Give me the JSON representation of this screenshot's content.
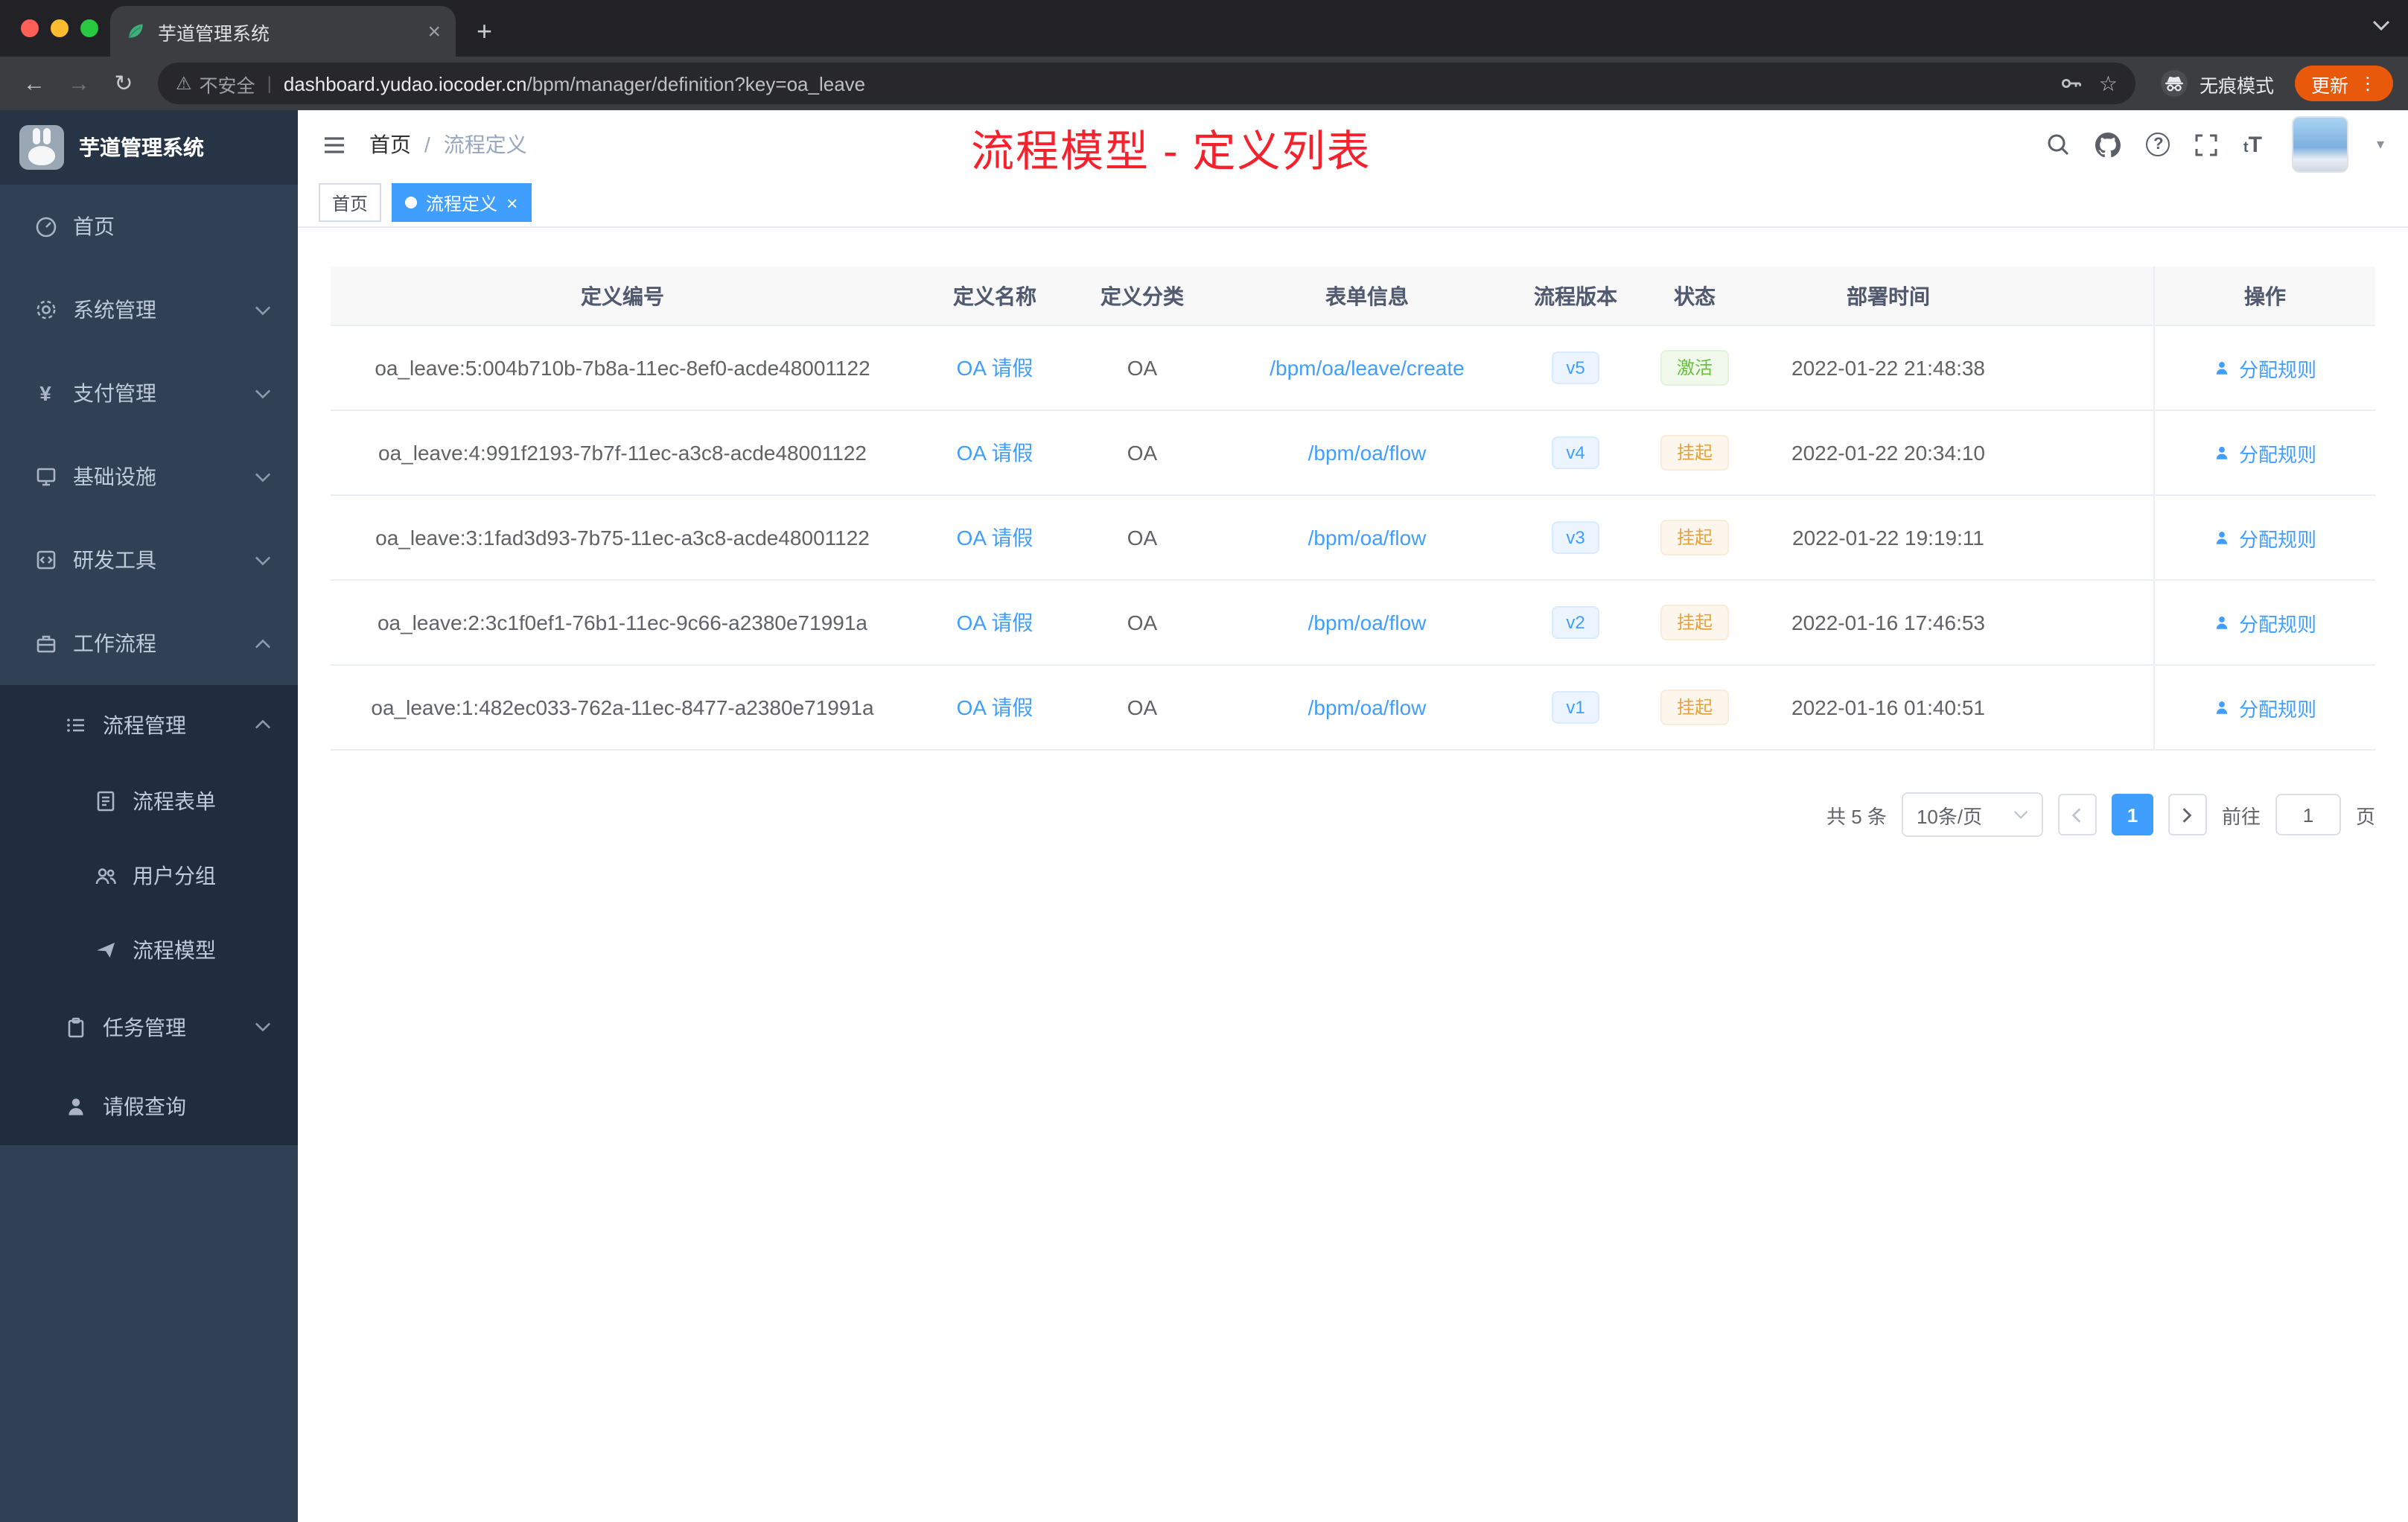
{
  "colors": {
    "accent": "#409eff",
    "success": "#67c23a",
    "warning": "#e6a23c",
    "annotation_red": "#f5222d",
    "sidebar_bg": "#304156",
    "submenu_bg": "#1f2d3d"
  },
  "icons": {
    "close": "×",
    "new_tab": "+",
    "back": "←",
    "forward": "→",
    "reload": "↻",
    "warning": "⚠",
    "star": "☆",
    "menu_dots": "⋮",
    "question": "?",
    "yen": "¥",
    "caret_down": "▾",
    "font_size": "tT",
    "separator": "|"
  },
  "browser": {
    "tab_title": "芋道管理系统",
    "security_label": "不安全",
    "url_domain": "dashboard.yudao.iocoder.cn",
    "url_path": "/bpm/manager/definition?key=oa_leave",
    "incognito_label": "无痕模式",
    "update_label": "更新"
  },
  "sidebar": {
    "title": "芋道管理系统",
    "items": [
      {
        "label": "首页"
      },
      {
        "label": "系统管理"
      },
      {
        "label": "支付管理"
      },
      {
        "label": "基础设施"
      },
      {
        "label": "研发工具"
      },
      {
        "label": "工作流程"
      },
      {
        "label": "流程管理"
      },
      {
        "label": "流程表单"
      },
      {
        "label": "用户分组"
      },
      {
        "label": "流程模型"
      },
      {
        "label": "任务管理"
      },
      {
        "label": "请假查询"
      }
    ]
  },
  "header": {
    "breadcrumb": {
      "home": "首页",
      "separator": "/",
      "current": "流程定义"
    },
    "annotation": "流程模型 - 定义列表"
  },
  "tags": {
    "home": "首页",
    "active": "流程定义"
  },
  "table": {
    "columns": {
      "id": "定义编号",
      "name": "定义名称",
      "category": "定义分类",
      "form": "表单信息",
      "version": "流程版本",
      "status": "状态",
      "deploy_time": "部署时间",
      "operations": "操作"
    },
    "action_label": "分配规则",
    "rows": [
      {
        "id": "oa_leave:5:004b710b-7b8a-11ec-8ef0-acde48001122",
        "name": "OA 请假",
        "category": "OA",
        "form": "/bpm/oa/leave/create",
        "version": "v5",
        "status": "激活",
        "status_type": "success",
        "time": "2022-01-22 21:48:38"
      },
      {
        "id": "oa_leave:4:991f2193-7b7f-11ec-a3c8-acde48001122",
        "name": "OA 请假",
        "category": "OA",
        "form": "/bpm/oa/flow",
        "version": "v4",
        "status": "挂起",
        "status_type": "warning",
        "time": "2022-01-22 20:34:10"
      },
      {
        "id": "oa_leave:3:1fad3d93-7b75-11ec-a3c8-acde48001122",
        "name": "OA 请假",
        "category": "OA",
        "form": "/bpm/oa/flow",
        "version": "v3",
        "status": "挂起",
        "status_type": "warning",
        "time": "2022-01-22 19:19:11"
      },
      {
        "id": "oa_leave:2:3c1f0ef1-76b1-11ec-9c66-a2380e71991a",
        "name": "OA 请假",
        "category": "OA",
        "form": "/bpm/oa/flow",
        "version": "v2",
        "status": "挂起",
        "status_type": "warning",
        "time": "2022-01-16 17:46:53"
      },
      {
        "id": "oa_leave:1:482ec033-762a-11ec-8477-a2380e71991a",
        "name": "OA 请假",
        "category": "OA",
        "form": "/bpm/oa/flow",
        "version": "v1",
        "status": "挂起",
        "status_type": "warning",
        "time": "2022-01-16 01:40:51"
      }
    ]
  },
  "pagination": {
    "total": "共 5 条",
    "page_size": "10条/页",
    "current_page": "1",
    "goto_label": "前往",
    "goto_value": "1",
    "unit_label": "页"
  }
}
